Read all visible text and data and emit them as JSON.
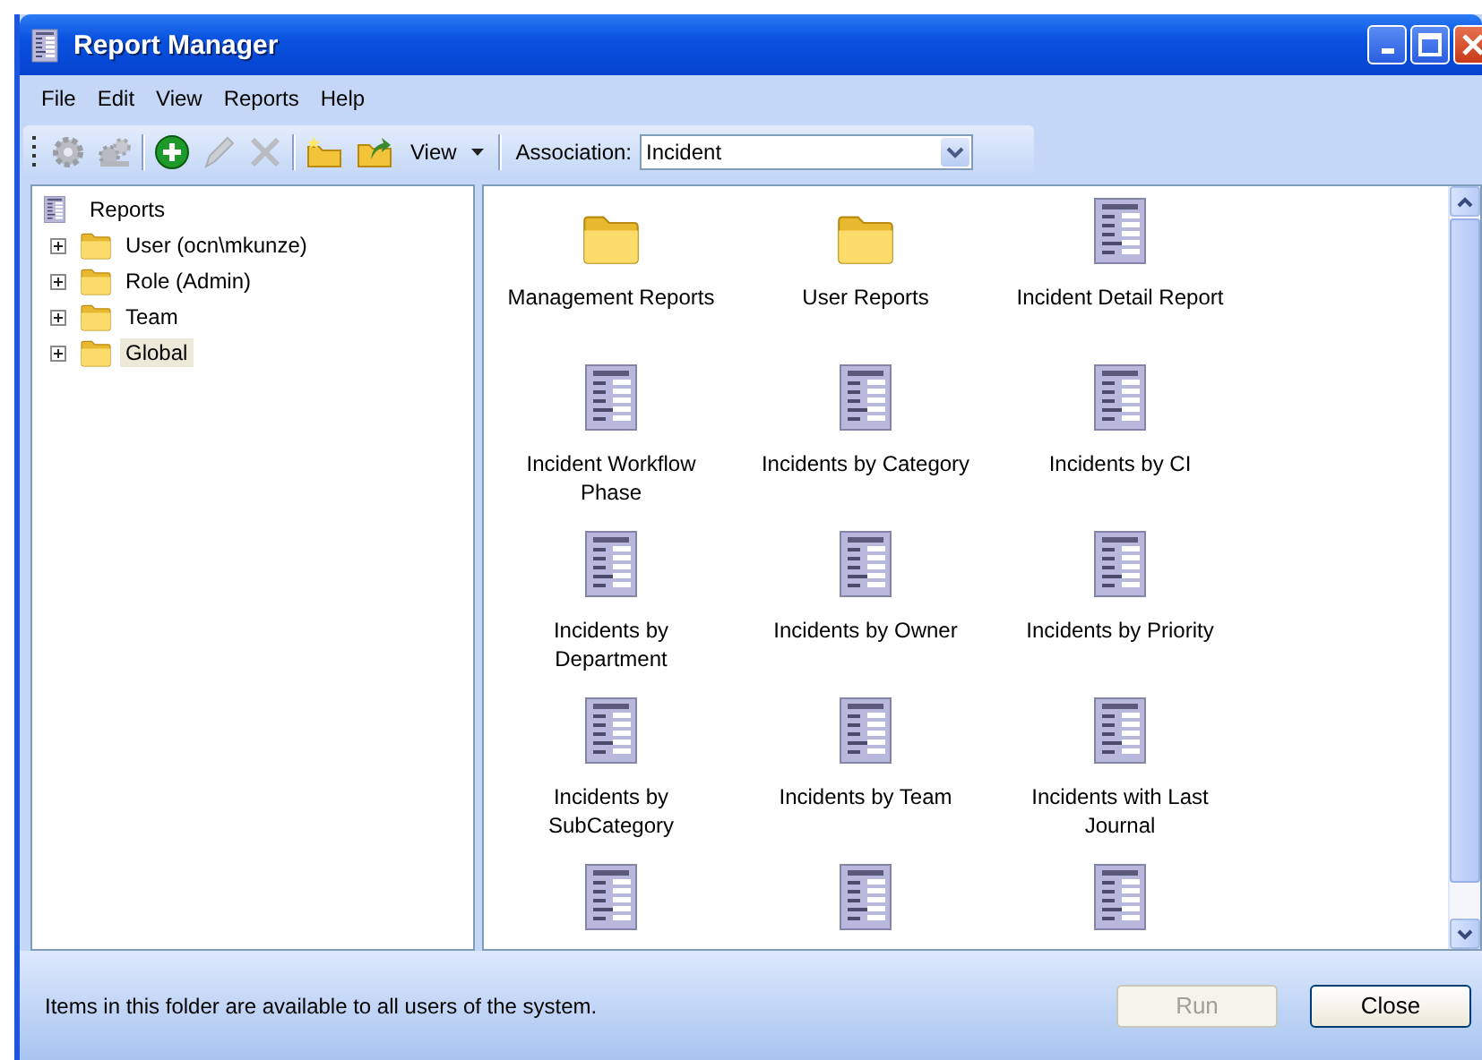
{
  "window": {
    "title": "Report Manager"
  },
  "menu": [
    "File",
    "Edit",
    "View",
    "Reports",
    "Help"
  ],
  "toolbar": [
    {
      "kind": "run",
      "disabled": true
    },
    {
      "kind": "schedule",
      "disabled": true
    },
    {
      "kind": "add",
      "disabled": false
    },
    {
      "kind": "edit",
      "disabled": true
    },
    {
      "kind": "delete",
      "disabled": true
    },
    {
      "kind": "new-folder",
      "disabled": false
    },
    {
      "kind": "move-folder",
      "disabled": false
    }
  ],
  "view_menu": {
    "label": "View"
  },
  "association": {
    "label": "Association:",
    "value": "Incident"
  },
  "tree": {
    "label": "Reports",
    "children": [
      {
        "label": "User (ocn\\mkunze)",
        "expanded": false,
        "selected": false
      },
      {
        "label": "Role (Admin)",
        "expanded": false,
        "selected": false
      },
      {
        "label": "Team",
        "expanded": false,
        "selected": false
      },
      {
        "label": "Global",
        "expanded": false,
        "selected": true
      }
    ]
  },
  "items": [
    {
      "kind": "folder",
      "label": "Management Reports"
    },
    {
      "kind": "folder",
      "label": "User Reports"
    },
    {
      "kind": "report",
      "label": "Incident Detail Report"
    },
    {
      "kind": "report",
      "label": "Incident Workflow Phase"
    },
    {
      "kind": "report",
      "label": "Incidents by Category"
    },
    {
      "kind": "report",
      "label": "Incidents by CI"
    },
    {
      "kind": "report",
      "label": "Incidents by Department"
    },
    {
      "kind": "report",
      "label": "Incidents by Owner"
    },
    {
      "kind": "report",
      "label": "Incidents by Priority"
    },
    {
      "kind": "report",
      "label": "Incidents by SubCategory"
    },
    {
      "kind": "report",
      "label": "Incidents by Team"
    },
    {
      "kind": "report",
      "label": "Incidents with Last Journal"
    },
    {
      "kind": "report"
    },
    {
      "kind": "report"
    },
    {
      "kind": "report"
    }
  ],
  "status_bar": {
    "text": "Items in this folder are available to all users of the system."
  },
  "buttons": [
    {
      "label": "Run",
      "disabled": true
    },
    {
      "label": "Close",
      "disabled": false
    }
  ]
}
